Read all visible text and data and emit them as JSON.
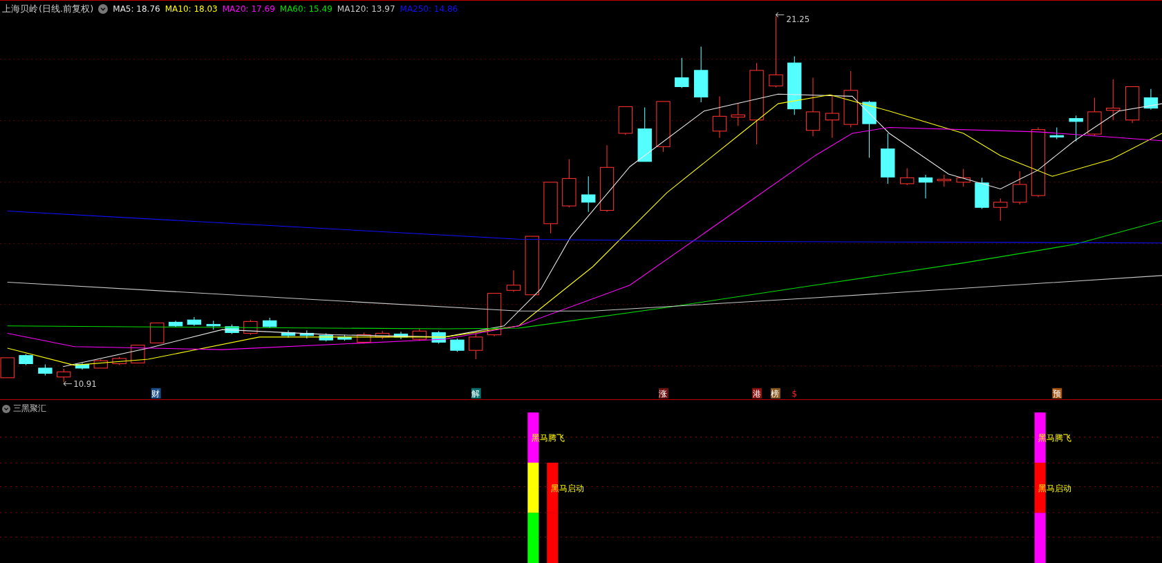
{
  "title": {
    "stock": "上海贝岭",
    "period": "(日线.前复权)"
  },
  "ma_legend": [
    {
      "label": "MA5: 18.76",
      "color": "#e8e8e8"
    },
    {
      "label": "MA10: 18.03",
      "color": "#ffff00"
    },
    {
      "label": "MA20: 17.69",
      "color": "#ff00ff"
    },
    {
      "label": "MA60: 15.49",
      "color": "#00e000"
    },
    {
      "label": "MA120: 13.97",
      "color": "#c8c8c8"
    },
    {
      "label": "MA250: 14.86",
      "color": "#1010ff"
    }
  ],
  "price_marks": [
    {
      "kind": "high",
      "text": "21.25"
    },
    {
      "kind": "low",
      "text": "10.91"
    }
  ],
  "event_tags": [
    {
      "kind": "badge",
      "text": "财",
      "color": "#1d4f8c"
    },
    {
      "kind": "badge",
      "text": "解",
      "color": "#0b7070"
    },
    {
      "kind": "badge",
      "text": "涨",
      "color": "#6e1212"
    },
    {
      "kind": "badge",
      "text": "港",
      "color": "#8c1010"
    },
    {
      "kind": "badge",
      "text": "榜",
      "color": "#8a5a22"
    },
    {
      "kind": "plain",
      "text": "$",
      "color": "#ff2020"
    },
    {
      "kind": "badge",
      "text": "预",
      "color": "#a85412"
    }
  ],
  "indicator": {
    "name": "三黑聚汇",
    "columns": [
      {
        "segments": [
          {
            "color": "#ff00ff",
            "label": "黑马腾飞"
          },
          {
            "color": "#ffff00"
          },
          {
            "color": "#00ff00"
          }
        ]
      },
      {
        "segments": [
          {
            "color": "#ff0000",
            "label": "黑马启动"
          },
          {
            "color": "#ff0000"
          }
        ]
      },
      {
        "segments": [
          {
            "color": "#ff00ff",
            "label": "黑马腾飞"
          },
          {
            "color": "#ff0000",
            "label": "黑马启动"
          },
          {
            "color": "#ff00ff"
          }
        ]
      }
    ]
  }
}
